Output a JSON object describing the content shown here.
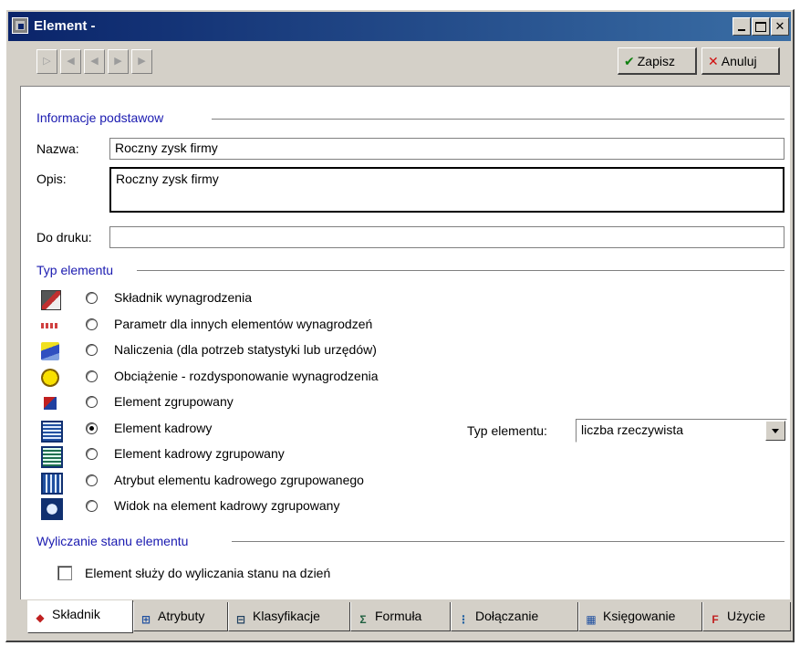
{
  "window": {
    "title": "Element -"
  },
  "toolbar": {
    "nav": [
      "first",
      "prev-record",
      "prev",
      "next",
      "last"
    ],
    "save_label": "Zapisz",
    "cancel_label": "Anuluj",
    "save_icon": "✔",
    "cancel_icon": "✕"
  },
  "basic": {
    "section": "Informacje podstawow",
    "name_label": "Nazwa:",
    "name_value": "Roczny zysk firmy",
    "desc_label": "Opis:",
    "desc_value": "Roczny zysk firmy",
    "print_label": "Do druku:",
    "print_value": ""
  },
  "element_type": {
    "section": "Typ elementu",
    "options": [
      {
        "label": "Składnik wynagrodzenia",
        "icon": "wage-component-icon",
        "selected": false
      },
      {
        "label": "Parametr dla innych elementów wynagrodzeń",
        "icon": "parameter-icon",
        "selected": false
      },
      {
        "label": "Naliczenia (dla potrzeb statystyki lub urzędów)",
        "icon": "accrual-icon",
        "selected": false
      },
      {
        "label": "Obciążenie - rozdysponowanie wynagrodzenia",
        "icon": "charge-icon",
        "selected": false
      },
      {
        "label": "Element zgrupowany",
        "icon": "grouped-element-icon",
        "selected": false
      },
      {
        "label": "Element kadrowy",
        "icon": "hr-element-icon",
        "selected": true
      },
      {
        "label": "Element kadrowy zgrupowany",
        "icon": "hr-grouped-icon",
        "selected": false
      },
      {
        "label": "Atrybut elementu kadrowego zgrupowanego",
        "icon": "hr-attribute-icon",
        "selected": false
      },
      {
        "label": "Widok na element kadrowy zgrupowany",
        "icon": "hr-view-icon",
        "selected": false
      }
    ],
    "type_label": "Typ elementu:",
    "type_value": "liczba rzeczywista"
  },
  "state": {
    "section": "Wyliczanie stanu elementu",
    "checkbox_label": "Element służy do wyliczania stanu na dzień",
    "checked": false
  },
  "tabs": [
    {
      "label": "Składnik",
      "icon": "component-tab-icon",
      "active": true
    },
    {
      "label": "Atrybuty",
      "icon": "attributes-tab-icon",
      "active": false
    },
    {
      "label": "Klasyfikacje",
      "icon": "classification-tab-icon",
      "active": false
    },
    {
      "label": "Formuła",
      "icon": "formula-tab-icon",
      "active": false
    },
    {
      "label": "Dołączanie",
      "icon": "attach-tab-icon",
      "active": false
    },
    {
      "label": "Księgowanie",
      "icon": "accounting-tab-icon",
      "active": false
    },
    {
      "label": "Użycie",
      "icon": "usage-tab-icon",
      "active": false
    }
  ]
}
